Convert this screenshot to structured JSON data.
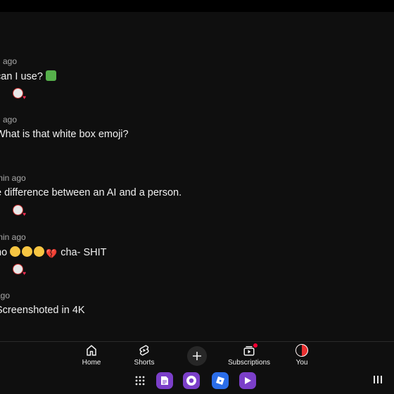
{
  "comments": [
    {
      "meta": "h ago",
      "text": "can I use?",
      "emoji": "puzzle",
      "has_reaction": true
    },
    {
      "meta": "h ago",
      "text": "What is that white box emoji?",
      "has_reaction": false
    },
    {
      "meta": "min ago",
      "text": "e difference between an AI and a person.",
      "has_reaction": true
    },
    {
      "meta": " min ago",
      "text_start": "no",
      "text_end": "cha-  SHIT",
      "has_reaction": true
    },
    {
      "meta": "ago",
      "text": "Screenshoted in 4K",
      "has_reaction": false
    }
  ],
  "nav": {
    "home": "Home",
    "shorts": "Shorts",
    "subscriptions": "Subscriptions",
    "you": "You"
  },
  "colors": {
    "background": "#0f0f0f",
    "notification_dot": "#ff0033"
  },
  "taskbar": {
    "icons": [
      "app-grid-icon",
      "docs-app-icon",
      "chrome-app-icon",
      "roblox-app-icon",
      "play-games-app-icon"
    ]
  }
}
